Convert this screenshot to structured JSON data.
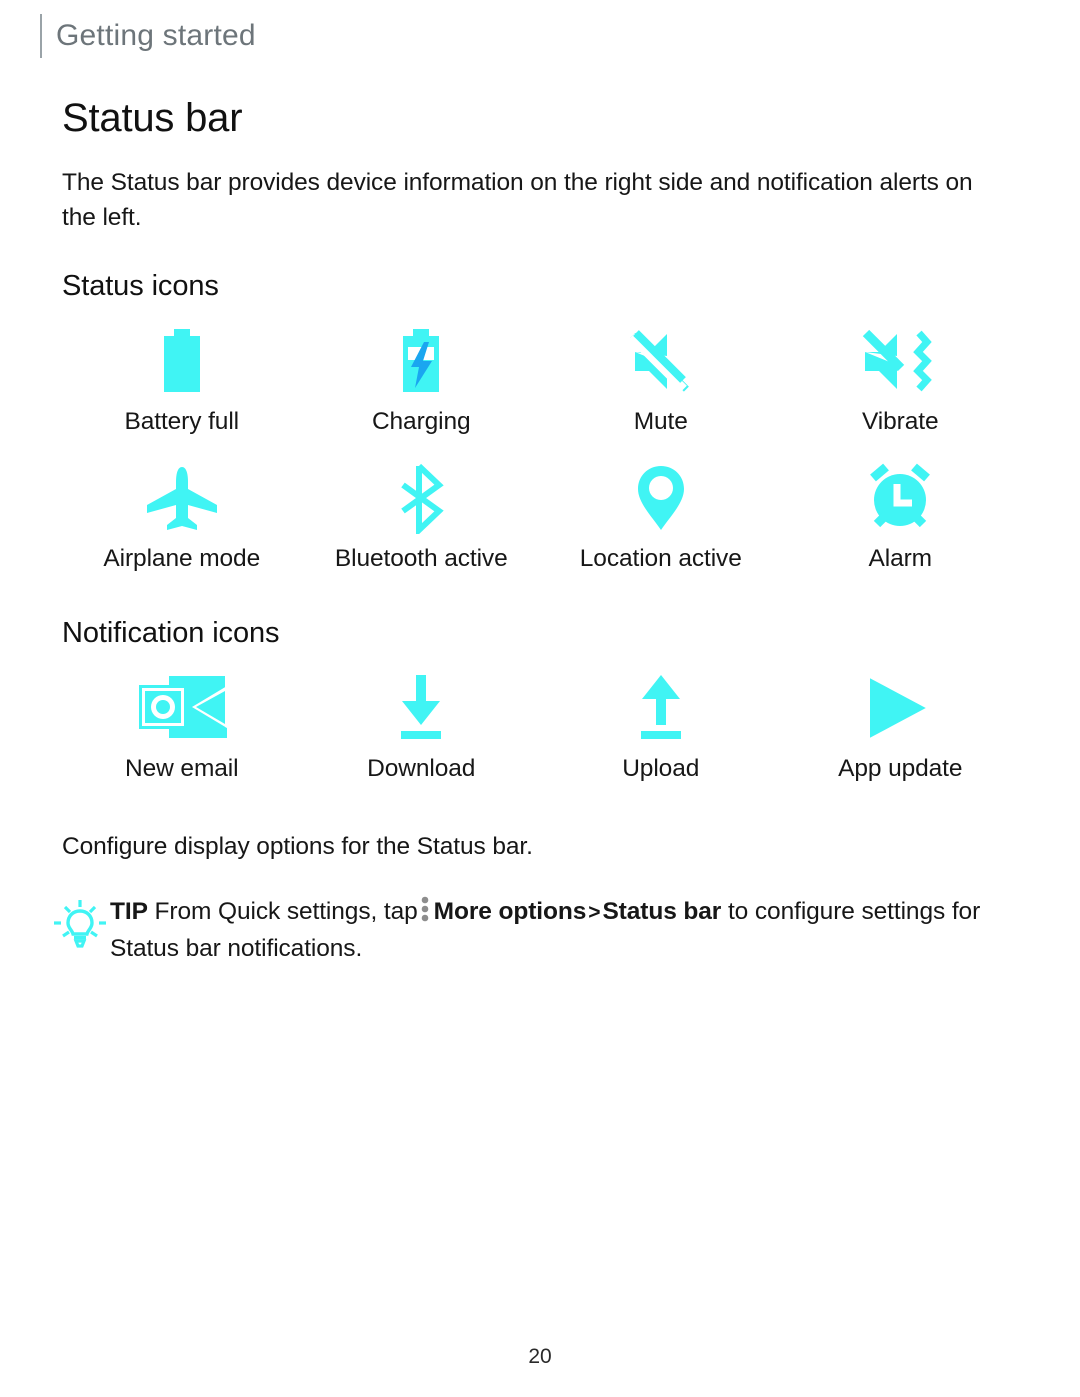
{
  "header": {
    "running_title": "Getting started"
  },
  "page": {
    "title": "Status bar",
    "intro": "The Status bar provides device information on the right side and notification alerts on the left.",
    "closing": "Configure display options for the Status bar.",
    "number": "20"
  },
  "sections": [
    {
      "heading": "Status icons"
    },
    {
      "heading": "Notification icons"
    }
  ],
  "status_icons": [
    {
      "icon": "battery-full-icon",
      "label": "Battery full"
    },
    {
      "icon": "battery-charging-icon",
      "label": "Charging"
    },
    {
      "icon": "mute-icon",
      "label": "Mute"
    },
    {
      "icon": "vibrate-icon",
      "label": "Vibrate"
    },
    {
      "icon": "airplane-mode-icon",
      "label": "Airplane mode"
    },
    {
      "icon": "bluetooth-icon",
      "label": "Bluetooth active"
    },
    {
      "icon": "location-pin-icon",
      "label": "Location active"
    },
    {
      "icon": "alarm-clock-icon",
      "label": "Alarm"
    }
  ],
  "notification_icons": [
    {
      "icon": "new-email-icon",
      "label": "New email"
    },
    {
      "icon": "download-icon",
      "label": "Download"
    },
    {
      "icon": "upload-icon",
      "label": "Upload"
    },
    {
      "icon": "app-update-icon",
      "label": "App update"
    }
  ],
  "tip": {
    "label": "TIP",
    "text_before_dots": "From Quick settings, tap",
    "dots_icon": "more-options-vertical-dots-icon",
    "bold_1": "More options",
    "separator": ">",
    "bold_2": "Status bar",
    "text_after": "to configure settings for Status bar notifications."
  },
  "colors": {
    "accent_cyan": "#40F4F4",
    "charging_blue": "#1AA6F0",
    "header_gray": "#6d757a",
    "dots_gray": "#8d8d8d"
  }
}
